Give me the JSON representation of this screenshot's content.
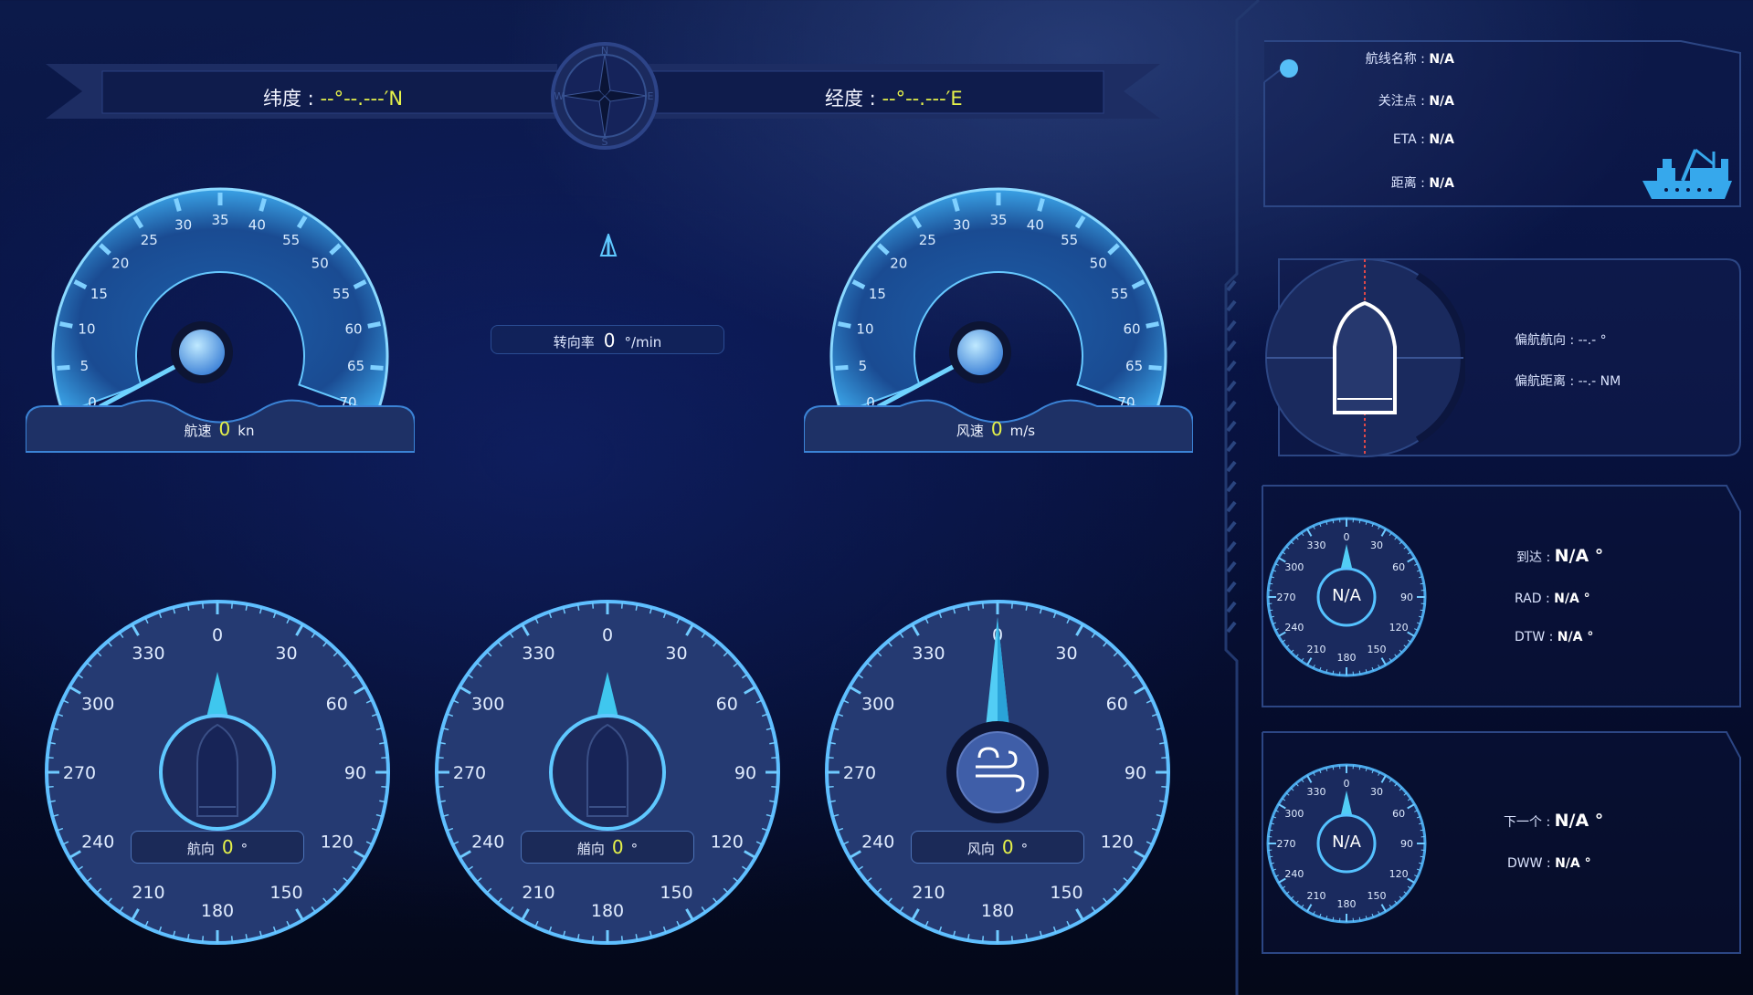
{
  "header": {
    "lat_label": "纬度 : ",
    "lat_value": "--°--.---′N",
    "lon_label": "经度 : ",
    "lon_value": "--°--.---′E",
    "compass_letters": [
      "N",
      "E",
      "S",
      "W"
    ]
  },
  "speed_gauge": {
    "ticks": [
      "0",
      "5",
      "10",
      "15",
      "20",
      "25",
      "30",
      "35",
      "40",
      "55",
      "50",
      "55",
      "60",
      "65",
      "70"
    ],
    "label": "航速",
    "value": "0",
    "unit": "kn"
  },
  "wind_speed_gauge": {
    "ticks": [
      "0",
      "5",
      "10",
      "15",
      "20",
      "25",
      "30",
      "35",
      "40",
      "55",
      "50",
      "55",
      "60",
      "65",
      "70"
    ],
    "label": "风速",
    "value": "0",
    "unit": "m/s"
  },
  "rate_of_turn": {
    "label": "转向率",
    "value": "0",
    "unit": "°/min"
  },
  "compass_ticks": [
    "0",
    "30",
    "60",
    "90",
    "120",
    "150",
    "180",
    "210",
    "240",
    "270",
    "300",
    "330"
  ],
  "heading_dial": {
    "label": "航向",
    "value": "0",
    "unit": "°"
  },
  "bow_dial": {
    "label": "艏向",
    "value": "0",
    "unit": "°"
  },
  "wind_dir_dial": {
    "label": "风向",
    "value": "0",
    "unit": "°"
  },
  "route_panel": {
    "route_name_label": "航线名称 :",
    "route_name_value": "N/A",
    "poi_label": "关注点 :",
    "poi_value": "N/A",
    "eta_label": "ETA :",
    "eta_value": "N/A",
    "distance_label": "距离 :",
    "distance_value": "N/A",
    "ship_icon": "cargo-ship-icon"
  },
  "offset_panel": {
    "course_label": "偏航航向 :",
    "course_value": "--.- °",
    "distance_label": "偏航距离 :",
    "distance_value": "--.- NM"
  },
  "arrival_panel": {
    "center": "N/A",
    "arrive_label": "到达 :",
    "arrive_value": "N/A °",
    "rad_label": "RAD :",
    "rad_value": "N/A °",
    "dtw_label": "DTW :",
    "dtw_value": "N/A °"
  },
  "next_panel": {
    "center": "N/A",
    "next_label": "下一个 :",
    "next_value": "N/A °",
    "dww_label": "DWW :",
    "dww_value": "N/A °"
  },
  "colors": {
    "accent": "#4fb8ff",
    "value_yellow": "#e6f24a",
    "panel_border": "#2a4c93",
    "dial_fill": "#253a72"
  }
}
